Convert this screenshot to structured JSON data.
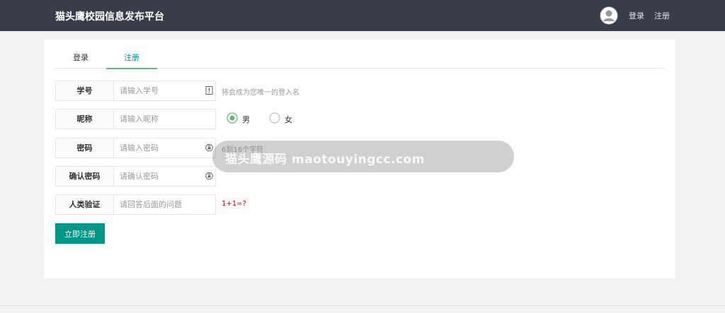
{
  "header": {
    "brand": "猫头鹰校园信息发布平台",
    "login": "登录",
    "register": "注册"
  },
  "tabs": [
    {
      "label": "登录",
      "active": false
    },
    {
      "label": "注册",
      "active": true
    }
  ],
  "form": {
    "student_id": {
      "label": "学号",
      "placeholder": "请输入学号",
      "hint": "将会成为您唯一的登入名"
    },
    "nickname": {
      "label": "昵称",
      "placeholder": "请输入昵称"
    },
    "gender": {
      "options": [
        "男",
        "女"
      ],
      "selected": "男"
    },
    "password": {
      "label": "密码",
      "placeholder": "请输入密码",
      "hint": "6到16个字符"
    },
    "confirm_password": {
      "label": "确认密码",
      "placeholder": "请确认密码"
    },
    "captcha": {
      "label": "人类验证",
      "placeholder": "请回答后面的问题",
      "question": "1+1=?"
    },
    "submit": "立即注册"
  },
  "watermark": "猫头鹰源码 maotouyingcc.com",
  "colors": {
    "topbar": "#393d49",
    "accent": "#009688",
    "tab_underline": "#5fb878",
    "hint_red": "#cc0000"
  }
}
